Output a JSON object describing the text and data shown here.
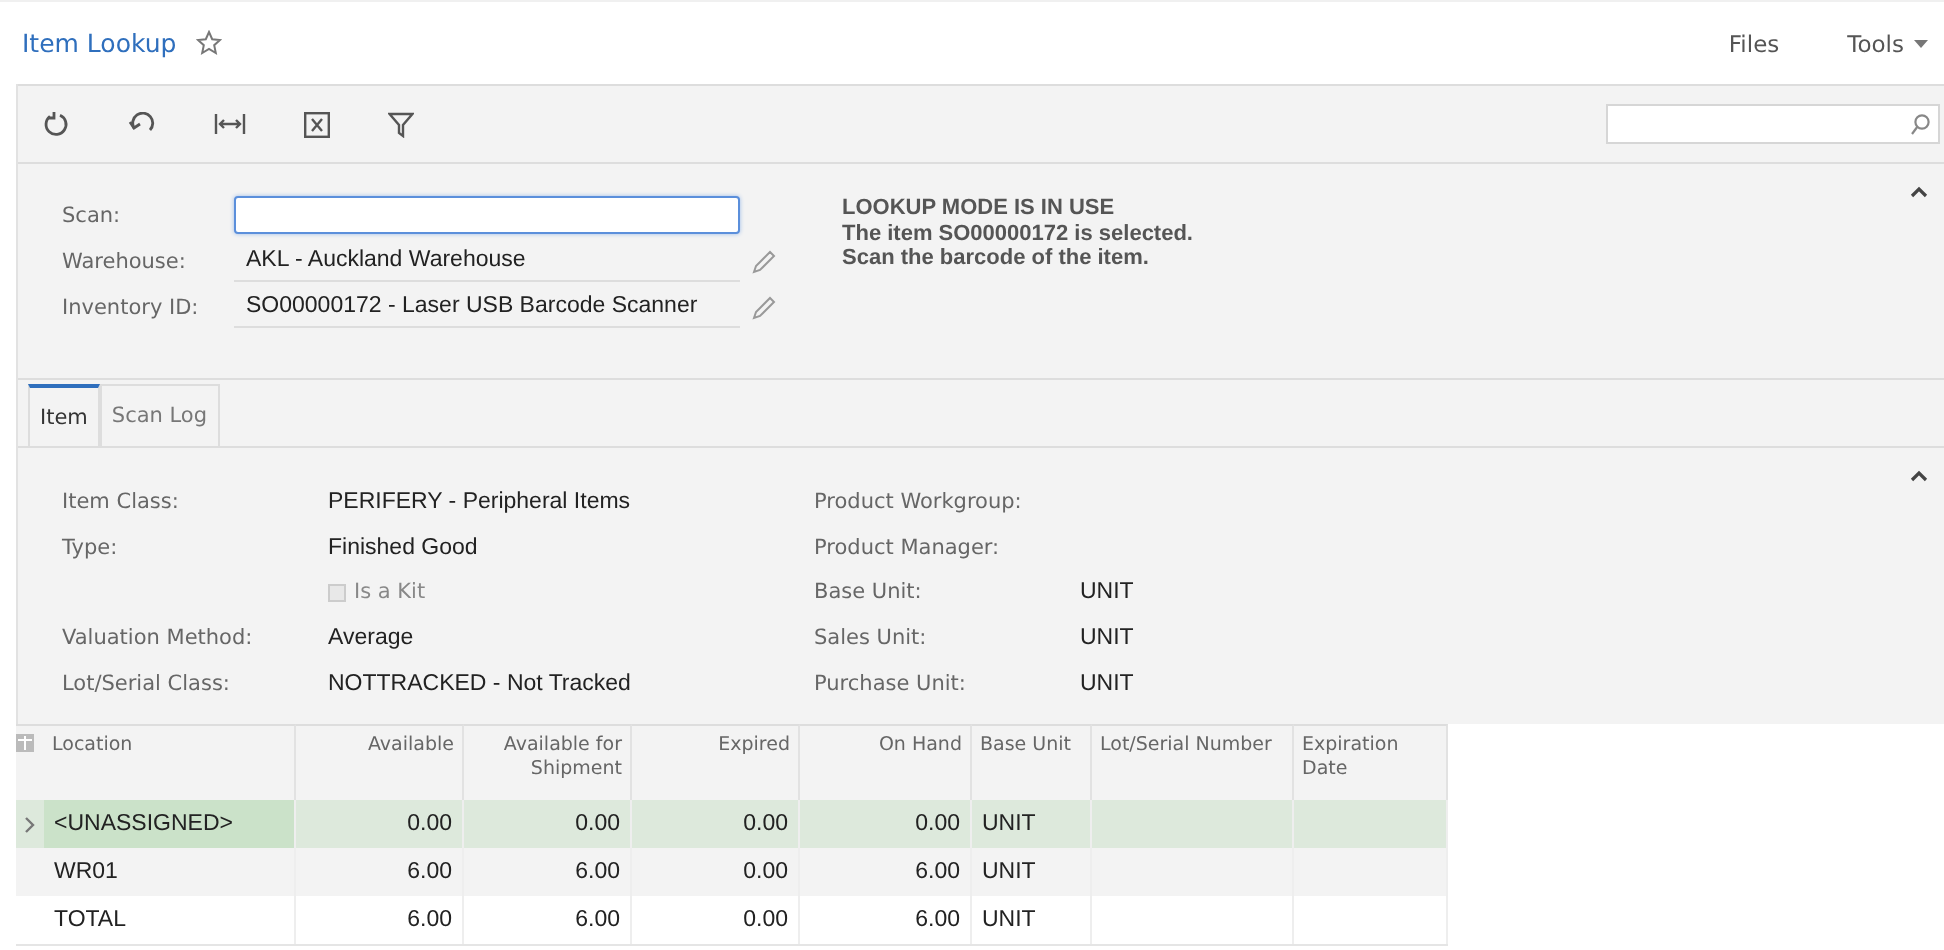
{
  "window": {
    "title": "Item Lookup"
  },
  "header_links": [
    {
      "label": "Files",
      "kind": "link"
    },
    {
      "label": "Tools",
      "kind": "menu"
    }
  ],
  "toolbar": {
    "buttons": [
      {
        "kind": "refresh"
      },
      {
        "kind": "undo"
      },
      {
        "kind": "fit"
      },
      {
        "kind": "excel"
      },
      {
        "kind": "filter"
      }
    ]
  },
  "scan_form": {
    "fields": [
      {
        "label": "Scan:",
        "kind": "input"
      },
      {
        "label": "Warehouse:",
        "value": "AKL - Auckland Warehouse",
        "kind": "selector"
      },
      {
        "label": "Inventory ID:",
        "value": "SO00000172 - Laser USB Barcode Scanner",
        "kind": "selector"
      }
    ],
    "message": [
      "LOOKUP MODE IS IN USE",
      "The item SO00000172 is selected.",
      "Scan the barcode of the item."
    ]
  },
  "tabs": [
    {
      "label": "Item",
      "selected": true
    },
    {
      "label": "Scan Log",
      "selected": false
    }
  ],
  "item_details": {
    "left": [
      {
        "label": "Item Class:",
        "value": "PERIFERY - Peripheral Items",
        "kind": "text"
      },
      {
        "label": "Type:",
        "value": "Finished Good",
        "kind": "text"
      },
      {
        "label": "Is a Kit",
        "checked": false,
        "kind": "checkbox"
      },
      {
        "label": "Valuation Method:",
        "value": "Average",
        "kind": "text"
      },
      {
        "label": "Lot/Serial Class:",
        "value": "NOTTRACKED - Not Tracked",
        "kind": "text"
      }
    ],
    "right": [
      {
        "label": "Product Workgroup:"
      },
      {
        "label": "Product Manager:"
      },
      {
        "label": "Base Unit:",
        "value": "UNIT"
      },
      {
        "label": "Sales Unit:",
        "value": "UNIT"
      },
      {
        "label": "Purchase Unit:",
        "value": "UNIT"
      }
    ]
  },
  "table": {
    "columns": [
      {
        "label": "Location",
        "kind": "text"
      },
      {
        "label": "Available",
        "kind": "number"
      },
      {
        "label": "Available for Shipment",
        "kind": "number"
      },
      {
        "label": "Expired",
        "kind": "number"
      },
      {
        "label": "On Hand",
        "kind": "number"
      },
      {
        "label": "Base Unit",
        "kind": "text"
      },
      {
        "label": "Lot/Serial Number",
        "kind": "text"
      },
      {
        "label": "Expiration Date",
        "kind": "text"
      }
    ],
    "rows": [
      {
        "selected": true,
        "cells": [
          "<UNASSIGNED>",
          "0.00",
          "0.00",
          "0.00",
          "0.00",
          "UNIT"
        ]
      },
      {
        "selected": false,
        "cells": [
          "WR01",
          "6.00",
          "6.00",
          "0.00",
          "6.00",
          "UNIT"
        ]
      },
      {
        "selected": false,
        "cells": [
          "TOTAL",
          "6.00",
          "6.00",
          "0.00",
          "6.00",
          "UNIT"
        ]
      }
    ]
  }
}
